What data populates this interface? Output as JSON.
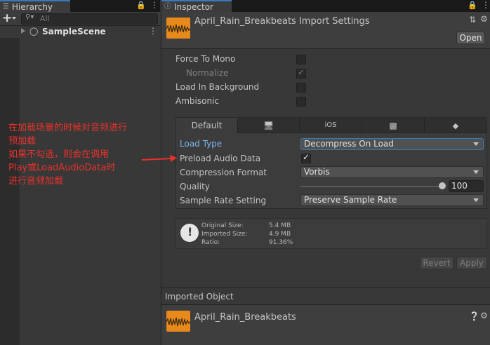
{
  "hierarchy": {
    "tab_label": "Hierarchy",
    "search_placeholder": "All",
    "add_label": "+",
    "scene_name": "SampleScene"
  },
  "inspector": {
    "tab_label": "Inspector",
    "title": "April_Rain_Breakbeats Import Settings",
    "open_button": "Open",
    "force_to_mono": {
      "label": "Force To Mono",
      "checked": false
    },
    "normalize": {
      "label": "Normalize",
      "checked": true
    },
    "load_in_background": {
      "label": "Load In Background",
      "checked": false
    },
    "ambisonic": {
      "label": "Ambisonic",
      "checked": false
    },
    "platform_tabs": [
      "Default",
      "monitor-icon",
      "iOS",
      "android-icon",
      "html5-icon"
    ],
    "default_tab_label": "Default",
    "ios_tab_label": "iOS",
    "load_type": {
      "label": "Load Type",
      "value": "Decompress On Load"
    },
    "preload_audio_data": {
      "label": "Preload Audio Data",
      "checked": true
    },
    "compression_format": {
      "label": "Compression Format",
      "value": "Vorbis"
    },
    "quality": {
      "label": "Quality",
      "value": "100",
      "fraction": 1.0
    },
    "sample_rate_setting": {
      "label": "Sample Rate Setting",
      "value": "Preserve Sample Rate"
    },
    "info": {
      "original_size_label": "Original Size:",
      "original_size_value": "5.4 MB",
      "imported_size_label": "Imported Size:",
      "imported_size_value": "4.9 MB",
      "ratio_label": "Ratio:",
      "ratio_value": "91.36%"
    },
    "revert_button": "Revert",
    "apply_button": "Apply",
    "imported_object_header": "Imported Object",
    "imported_object_name": "April_Rain_Breakbeats"
  },
  "annotation": {
    "line1": "在加载场景的时候对音频进行",
    "line2": "预加载",
    "line3": "如果不勾选，则会在调用",
    "line4": "Play或LoadAudioData时",
    "line5": "进行音频加载"
  },
  "colors": {
    "accent": "#3a79bb",
    "annotation": "#e8322b",
    "audio_icon": "#e8891c",
    "panel_bg": "#383838"
  }
}
